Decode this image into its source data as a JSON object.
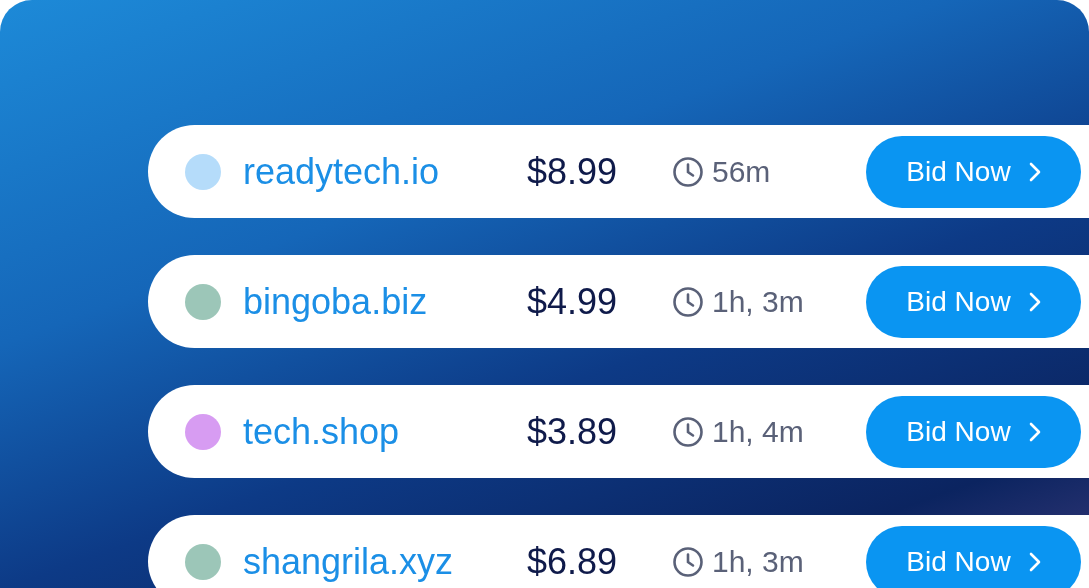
{
  "listings": [
    {
      "domain": "readytech.io",
      "price": "$8.99",
      "time": "56m",
      "color": "#b5dcfa",
      "button": "Bid Now"
    },
    {
      "domain": "bingoba.biz",
      "price": "$4.99",
      "time": "1h, 3m",
      "color": "#9cc6b8",
      "button": "Bid Now"
    },
    {
      "domain": "tech.shop",
      "price": "$3.89",
      "time": "1h, 4m",
      "color": "#d79cf2",
      "button": "Bid Now"
    },
    {
      "domain": "shangrila.xyz",
      "price": "$6.89",
      "time": "1h, 3m",
      "color": "#9cc6b8",
      "button": "Bid Now"
    }
  ]
}
